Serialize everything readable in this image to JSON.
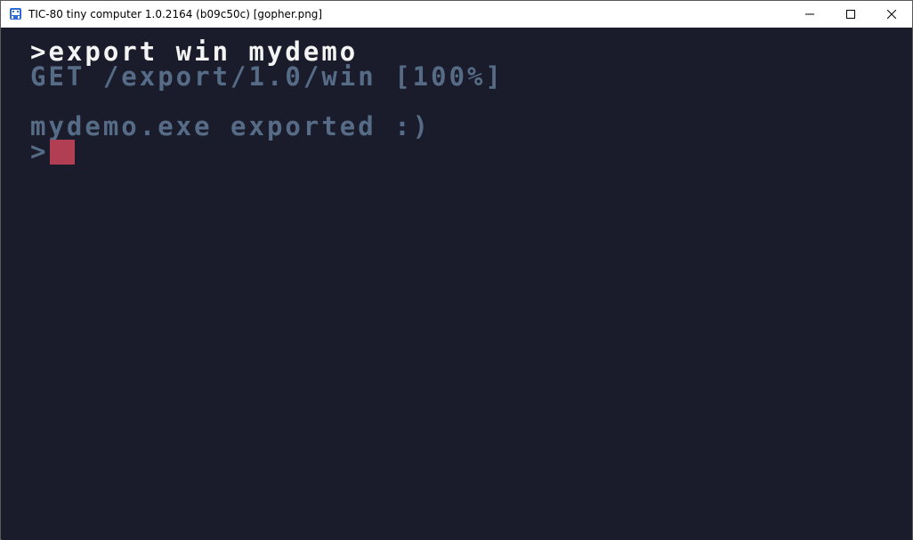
{
  "window": {
    "title": "TIC-80 tiny computer 1.0.2164 (b09c50c) [gopher.png]"
  },
  "console": {
    "lines": [
      {
        "text": ">export win mydemo"
      },
      {
        "text": "GET /export/1.0/win [100%]"
      },
      {
        "text": "mydemo.exe exported :)"
      },
      {
        "text": ">"
      }
    ]
  },
  "colors": {
    "background": "#1a1c2c",
    "command_text": "#f4f4f4",
    "output_text": "#566c86",
    "cursor": "#b13e53"
  },
  "icons": {
    "app": "tic80-app-icon",
    "minimize": "minimize-icon",
    "maximize": "maximize-icon",
    "close": "close-icon"
  }
}
